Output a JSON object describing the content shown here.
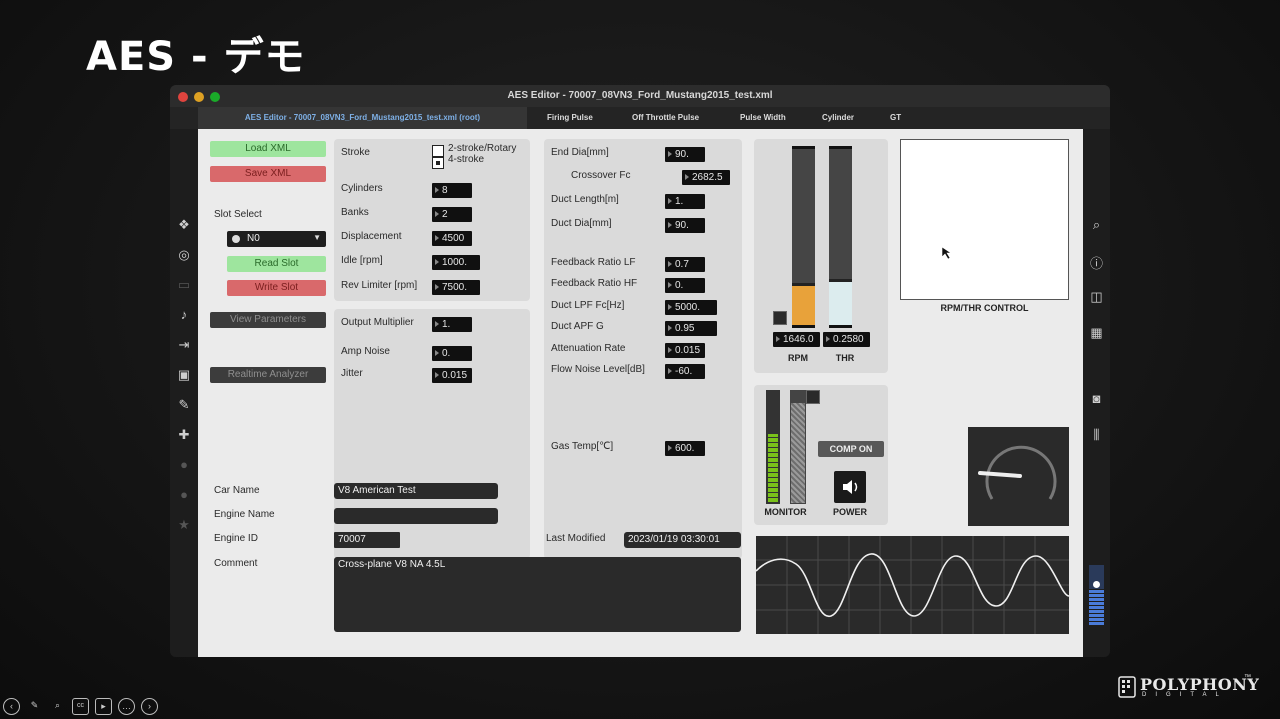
{
  "slide": {
    "title": "AES - デモ"
  },
  "window": {
    "title": "AES Editor - 70007_08VN3_Ford_Mustang2015_test.xml"
  },
  "tabs": [
    {
      "label": "AES Editor - 70007_08VN3_Ford_Mustang2015_test.xml (root)",
      "active": true
    },
    {
      "label": "Firing Pulse"
    },
    {
      "label": "Off Throttle Pulse"
    },
    {
      "label": "Pulse Width"
    },
    {
      "label": "Cylinder"
    },
    {
      "label": "GT"
    }
  ],
  "left_controls": {
    "load_xml": "Load XML",
    "save_xml": "Save XML",
    "slot_select_label": "Slot Select",
    "slot_value": "N0",
    "read_slot": "Read Slot",
    "write_slot": "Write Slot",
    "view_parameters": "View Parameters",
    "realtime_analyzer": "Realtime Analyzer"
  },
  "engine": {
    "stroke_label": "Stroke",
    "stroke_options": [
      "2-stroke/Rotary",
      "4-stroke"
    ],
    "stroke_selected": "4-stroke",
    "cylinders_label": "Cylinders",
    "cylinders": "8",
    "banks_label": "Banks",
    "banks": "2",
    "displacement_label": "Displacement",
    "displacement": "4500",
    "idle_label": "Idle [rpm]",
    "idle": "1000.",
    "rev_limiter_label": "Rev Limiter [rpm]",
    "rev_limiter": "7500."
  },
  "output": {
    "output_multiplier_label": "Output Multiplier",
    "output_multiplier": "1.",
    "amp_noise_label": "Amp Noise",
    "amp_noise": "0.",
    "jitter_label": "Jitter",
    "jitter": "0.015"
  },
  "duct": {
    "end_dia_label": "End Dia[mm]",
    "end_dia": "90.",
    "crossover_label": "Crossover Fc",
    "crossover": "2682.5",
    "duct_length_label": "Duct Length[m]",
    "duct_length": "1.",
    "duct_dia_label": "Duct Dia[mm]",
    "duct_dia": "90.",
    "feedback_lf_label": "Feedback Ratio LF",
    "feedback_lf": "0.7",
    "feedback_hf_label": "Feedback Ratio HF",
    "feedback_hf": "0.",
    "duct_lpf_label": "Duct LPF Fc[Hz]",
    "duct_lpf": "5000.",
    "duct_apf_label": "Duct APF G",
    "duct_apf": "0.95",
    "attenuation_label": "Attenuation Rate",
    "attenuation": "0.015",
    "flow_noise_label": "Flow Noise Level[dB]",
    "flow_noise": "-60.",
    "gas_temp_label": "Gas Temp[℃]",
    "gas_temp": "600."
  },
  "meters": {
    "rpm_value": "1646.0",
    "rpm_label": "RPM",
    "rpm_fill": 0.24,
    "thr_value": "0.2580",
    "thr_label": "THR",
    "thr_fill": 0.26,
    "control_label": "RPM/THR CONTROL",
    "monitor_label": "MONITOR",
    "power_label": "POWER",
    "comp_on": "COMP ON",
    "monitor_level": 0.6
  },
  "info": {
    "car_name_label": "Car Name",
    "car_name": "V8 American Test",
    "engine_name_label": "Engine Name",
    "engine_name": "",
    "engine_id_label": "Engine ID",
    "engine_id": "70007",
    "last_modified_label": "Last Modified",
    "last_modified": "2023/01/19 03:30:01",
    "comment_label": "Comment",
    "comment": "Cross-plane V8 NA 4.5L"
  },
  "logo": {
    "name": "POLYPHONY",
    "sub": "DIGITAL",
    "tm": "™"
  },
  "colors": {
    "accent_orange": "#e8a23a",
    "thr_light": "#dcecee",
    "green_button": "#9ee59e",
    "red_button": "#d9696b",
    "tab_active_text": "#7eb0e6"
  }
}
